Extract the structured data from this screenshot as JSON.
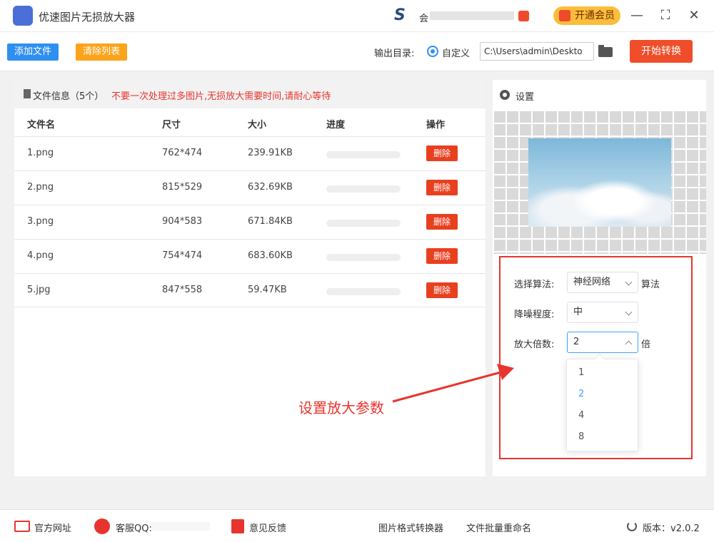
{
  "titlebar": {
    "app_title": "优速图片无损放大器",
    "user_prefix": "会",
    "vip_label": "开通会员",
    "minimize": "—",
    "maximize": "⛶",
    "close": "✕"
  },
  "toolbar": {
    "add_files": "添加文件",
    "clear_list": "清除列表",
    "output_label": "输出目录:",
    "radio_custom": "自定义",
    "output_path": "C:\\Users\\admin\\Deskto",
    "start": "开始转换"
  },
  "files": {
    "header_title": "文件信息（5个）",
    "header_warning": "不要一次处理过多图片,无损放大需要时间,请耐心等待",
    "columns": [
      "文件名",
      "尺寸",
      "大小",
      "进度",
      "操作"
    ],
    "delete_label": "删除",
    "rows": [
      {
        "name": "1.png",
        "size": "762*474",
        "filesize": "239.91KB",
        "progress": 0
      },
      {
        "name": "2.png",
        "size": "815*529",
        "filesize": "632.69KB",
        "progress": 0
      },
      {
        "name": "3.png",
        "size": "904*583",
        "filesize": "671.84KB",
        "progress": 0
      },
      {
        "name": "4.png",
        "size": "754*474",
        "filesize": "683.60KB",
        "progress": 0
      },
      {
        "name": "5.jpg",
        "size": "847*558",
        "filesize": "59.47KB",
        "progress": 0
      }
    ]
  },
  "settings": {
    "title": "设置",
    "algorithm_label": "选择算法:",
    "algorithm_value": "神经网络",
    "algorithm_suffix": "算法",
    "denoise_label": "降噪程度:",
    "denoise_value": "中",
    "scale_label": "放大倍数:",
    "scale_value": "2",
    "scale_suffix": "倍",
    "scale_options": [
      "1",
      "2",
      "4",
      "8"
    ],
    "scale_selected": "2"
  },
  "annotation": {
    "text": "设置放大参数",
    "color": "#e8342e"
  },
  "footer": {
    "website": "官方网址",
    "qq": "客服QQ:",
    "feedback": "意见反馈",
    "converter": "图片格式转换器",
    "rename": "文件批量重命名",
    "version": "版本：v2.0.2"
  },
  "colors": {
    "primary_blue": "#2f8ff0",
    "orange": "#fba41b",
    "red_button": "#f04e2a",
    "vip_yellow": "#fbbd3b",
    "select_focus": "#409eff"
  }
}
